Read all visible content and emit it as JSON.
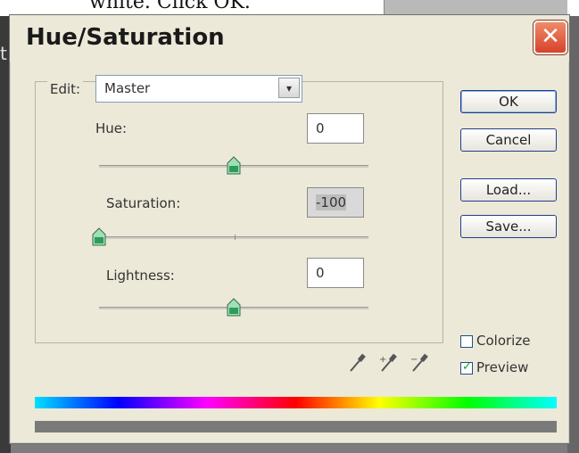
{
  "backdrop": {
    "top_text": "white. Click OK."
  },
  "dialog": {
    "title": "Hue/Saturation",
    "close_glyph": "✕",
    "edit": {
      "label": "Edit:",
      "value": "Master",
      "arrow": "▾"
    },
    "hue": {
      "label": "Hue:",
      "value": "0",
      "slider_fraction": 0.5
    },
    "saturation": {
      "label": "Saturation:",
      "value": "-100",
      "slider_fraction": 0.0
    },
    "lightness": {
      "label": "Lightness:",
      "value": "0",
      "slider_fraction": 0.5
    },
    "buttons": {
      "ok": "OK",
      "cancel": "Cancel",
      "load": "Load...",
      "save": "Save..."
    },
    "colorize": {
      "label": "Colorize",
      "checked": false
    },
    "preview": {
      "label": "Preview",
      "checked": true
    },
    "icons": [
      "eyedropper-icon",
      "eyedropper-plus-icon",
      "eyedropper-minus-icon"
    ],
    "colors": {
      "window": "#ece9d8",
      "close": "#d6432a",
      "button_border": "#1f3f8a",
      "check": "#1d9a2e"
    }
  }
}
